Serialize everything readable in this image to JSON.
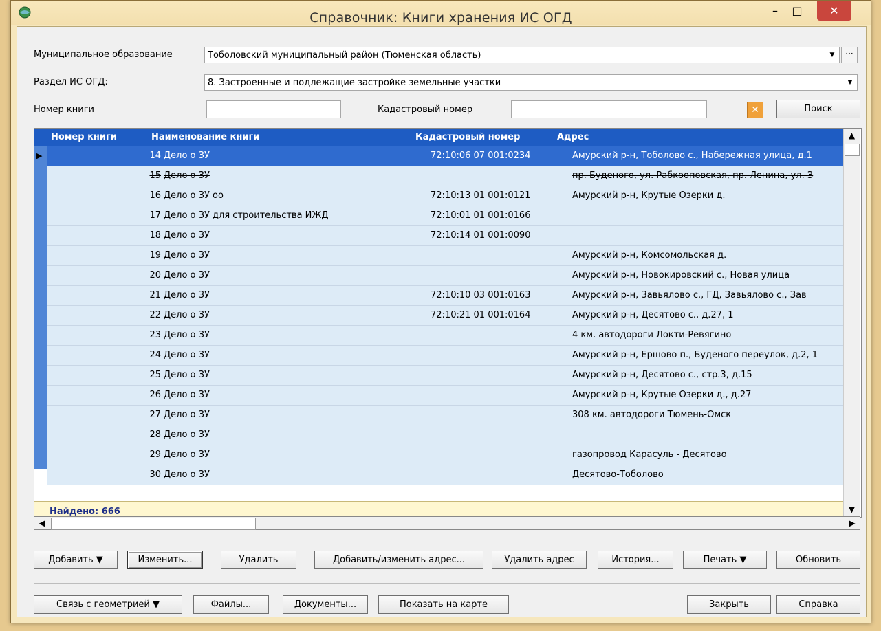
{
  "window": {
    "title": "Справочник: Книги хранения ИС ОГД",
    "minimize_glyph": "–",
    "maximize_glyph": "□",
    "close_glyph": "✕"
  },
  "filters": {
    "municipality_label": "Муниципальное образование",
    "municipality_value": "Тоболовский муниципальный район (Тюменская область)",
    "section_label": "Раздел ИС ОГД:",
    "section_value": "8. Застроенные и подлежащие застройке земельные участки",
    "book_number_label": "Номер книги",
    "book_number_value": "",
    "cadastral_label": "Кадастровый номер",
    "cadastral_value": "",
    "ellipsis_label": "···",
    "search_button": "Поиск"
  },
  "grid": {
    "columns": [
      "Номер книги",
      "Наименование книги",
      "Кадастровый номер",
      "Адрес"
    ],
    "rows": [
      {
        "num": "14",
        "name": "Дело о ЗУ",
        "cad": "72:10:06 07 001:0234",
        "addr": "Амурский р-н, Тоболово с., Набережная улица, д.1"
      },
      {
        "num": "15",
        "name": "Дело о ЗУ",
        "cad": "",
        "addr": "пр. Буденого, ул. Рабкооповская, пр. Ленина, ул. З"
      },
      {
        "num": "16",
        "name": "Дело о ЗУ оо",
        "cad": "72:10:13 01 001:0121",
        "addr": "Амурский р-н, Крутые Озерки д."
      },
      {
        "num": "17",
        "name": "Дело о ЗУ для строительства ИЖД",
        "cad": "72:10:01 01 001:0166",
        "addr": ""
      },
      {
        "num": "18",
        "name": "Дело о ЗУ",
        "cad": "72:10:14 01 001:0090",
        "addr": ""
      },
      {
        "num": "19",
        "name": "Дело о ЗУ",
        "cad": "",
        "addr": "Амурский р-н, Комсомольская д."
      },
      {
        "num": "20",
        "name": "Дело о ЗУ",
        "cad": "",
        "addr": "Амурский р-н, Новокировский с., Новая улица"
      },
      {
        "num": "21",
        "name": "Дело о ЗУ",
        "cad": "72:10:10 03 001:0163",
        "addr": "Амурский р-н, Завьялово с., ГД, Завьялово с., Зав"
      },
      {
        "num": "22",
        "name": "Дело о ЗУ",
        "cad": "72:10:21 01 001:0164",
        "addr": "Амурский р-н, Десятово с., д.27, 1"
      },
      {
        "num": "23",
        "name": "Дело о ЗУ",
        "cad": "",
        "addr": "4 км. автодороги Локти-Ревягино"
      },
      {
        "num": "24",
        "name": "Дело о ЗУ",
        "cad": "",
        "addr": "Амурский р-н, Ершово п., Буденого переулок, д.2, 1"
      },
      {
        "num": "25",
        "name": "Дело о ЗУ",
        "cad": "",
        "addr": "Амурский р-н, Десятово с., стр.3, д.15"
      },
      {
        "num": "26",
        "name": "Дело о ЗУ",
        "cad": "",
        "addr": "Амурский р-н, Крутые Озерки д., д.27"
      },
      {
        "num": "27",
        "name": "Дело о ЗУ",
        "cad": "",
        "addr": "308 км. автодороги Тюмень-Омск"
      },
      {
        "num": "28",
        "name": "Дело о ЗУ",
        "cad": "",
        "addr": ""
      },
      {
        "num": "29",
        "name": "Дело о ЗУ",
        "cad": "",
        "addr": "газопровод Карасуль - Десятово"
      },
      {
        "num": "30",
        "name": "Дело о ЗУ",
        "cad": "",
        "addr": "Десятово-Тоболово"
      }
    ],
    "found_text": "Найдено: 666"
  },
  "actions": {
    "add": "Добавить ▼",
    "edit": "Изменить...",
    "delete": "Удалить",
    "add_edit_address": "Добавить/изменить адрес...",
    "delete_address": "Удалить адрес",
    "history": "История...",
    "print": "Печать ▼",
    "refresh": "Обновить"
  },
  "bottom": {
    "geometry_link": "Связь с геометрией ▼",
    "files": "Файлы...",
    "documents": "Документы...",
    "show_on_map": "Показать на карте",
    "close": "Закрыть",
    "help": "Справка"
  },
  "icons": {
    "app": "globe-icon",
    "clear": "clear-icon",
    "combo_arrow": "▼",
    "row_pointer": "▶",
    "scroll_up": "▲",
    "scroll_down": "▼",
    "scroll_left": "◀",
    "scroll_right": "▶"
  },
  "colors": {
    "header_blue": "#1e5cc3",
    "selected_row": "#2f6bcf",
    "row_bg": "#ddebf7",
    "frame": "#f6e7bd",
    "close_red": "#c9463d"
  }
}
